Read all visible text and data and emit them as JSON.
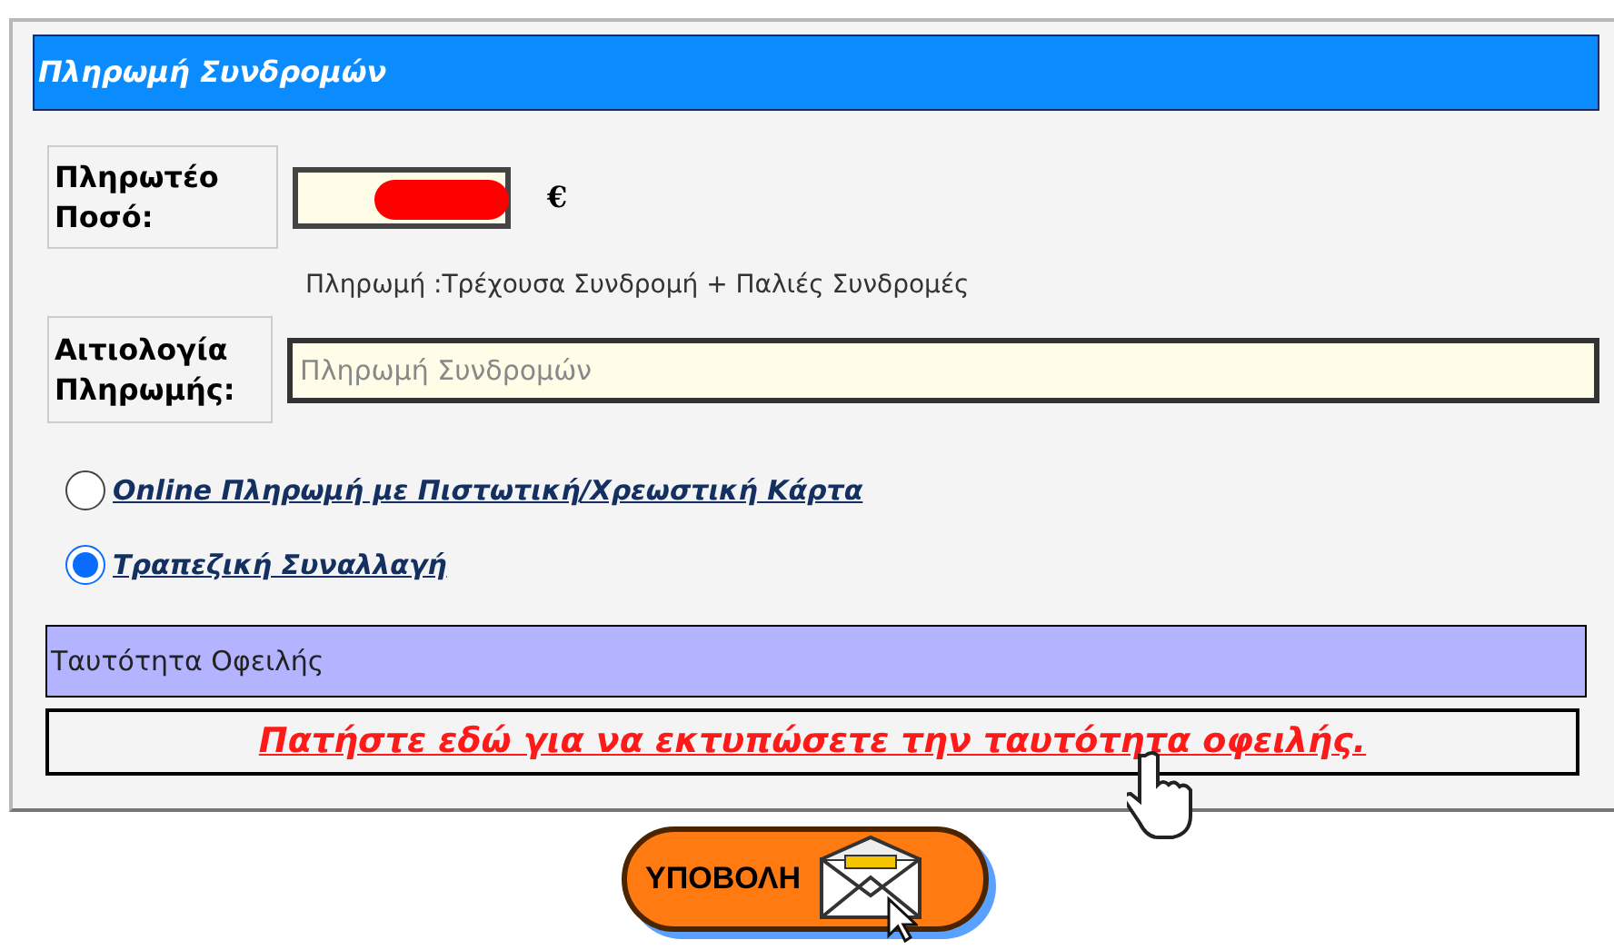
{
  "header": {
    "title": "Πληρωμή Συνδρομών"
  },
  "amount": {
    "label": "Πληρωτέο Ποσό:",
    "redacted": true,
    "currency": "€",
    "note": "Πληρωμή :Τρέχουσα Συνδρομή + Παλιές Συνδρομές"
  },
  "reason": {
    "label": "Αιτιολογία Πληρωμής:",
    "placeholder": "Πληρωμή Συνδρομών"
  },
  "payment_methods": [
    {
      "label": "Online Πληρωμή με Πιστωτική/Χρεωστική Κάρτα",
      "selected": false
    },
    {
      "label": "Τραπεζική Συναλλαγή",
      "selected": true
    }
  ],
  "debt_id": {
    "title": "Ταυτότητα Οφειλής",
    "link": "Πατήστε εδώ για να εκτυπώσετε την ταυτότητα οφειλής."
  },
  "submit": {
    "label": "ΥΠΟΒΟΛΗ"
  }
}
